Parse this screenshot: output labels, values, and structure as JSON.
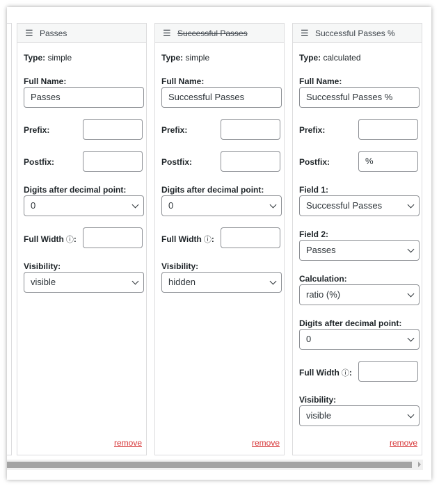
{
  "columns": [
    {
      "title": "Passes",
      "type_label": "Type:",
      "type_value": "simple",
      "full_name_label": "Full Name:",
      "full_name_value": "Passes",
      "prefix_label": "Prefix:",
      "prefix_value": "",
      "postfix_label": "Postfix:",
      "postfix_value": "",
      "digits_label": "Digits after decimal point:",
      "digits_value": "0",
      "full_width_label": "Full Width",
      "full_width_value": "",
      "visibility_label": "Visibility:",
      "visibility_value": "visible",
      "remove_label": "remove"
    },
    {
      "title": "Successful Passes",
      "type_label": "Type:",
      "type_value": "simple",
      "full_name_label": "Full Name:",
      "full_name_value": "Successful Passes",
      "prefix_label": "Prefix:",
      "prefix_value": "",
      "postfix_label": "Postfix:",
      "postfix_value": "",
      "digits_label": "Digits after decimal point:",
      "digits_value": "0",
      "full_width_label": "Full Width",
      "full_width_value": "",
      "visibility_label": "Visibility:",
      "visibility_value": "hidden",
      "remove_label": "remove"
    },
    {
      "title": "Successful Passes %",
      "type_label": "Type:",
      "type_value": "calculated",
      "full_name_label": "Full Name:",
      "full_name_value": "Successful Passes %",
      "prefix_label": "Prefix:",
      "prefix_value": "",
      "postfix_label": "Postfix:",
      "postfix_value": "%",
      "field1_label": "Field 1:",
      "field1_value": "Successful Passes",
      "field2_label": "Field 2:",
      "field2_value": "Passes",
      "calculation_label": "Calculation:",
      "calculation_value": "ratio (%)",
      "digits_label": "Digits after decimal point:",
      "digits_value": "0",
      "full_width_label": "Full Width",
      "full_width_value": "",
      "visibility_label": "Visibility:",
      "visibility_value": "visible",
      "remove_label": "remove"
    }
  ],
  "icons": {
    "handle": "hamburger-icon",
    "info": "info-icon",
    "chevron": "chevron-down-icon"
  },
  "colors": {
    "remove_link": "#d63638",
    "header_bg": "#f6f7f7",
    "border": "#dcdcde"
  }
}
